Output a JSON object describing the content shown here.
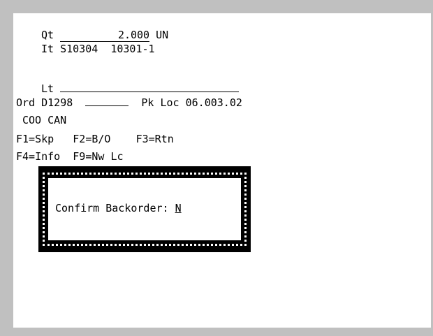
{
  "screen": {
    "qty_label": "Qt",
    "qty_value": "2.000",
    "qty_uom": "UN",
    "item_label": "It",
    "item_value": "S10304  10301-1",
    "lot_label": "Lt",
    "lot_value": "",
    "order_label": "Ord",
    "order_value": "D1298",
    "order_field_value": "",
    "pick_loc_label": "Pk Loc",
    "pick_loc_value": "06.003.02",
    "coo_label": "COO",
    "coo_value": "CAN",
    "fkeys_row1": "F1=Skp   F2=B/O    F3=Rtn",
    "fkeys_row2": "F4=Info  F9=Nw Lc"
  },
  "popup": {
    "prompt": "Confirm Backorder:",
    "answer": "N"
  }
}
